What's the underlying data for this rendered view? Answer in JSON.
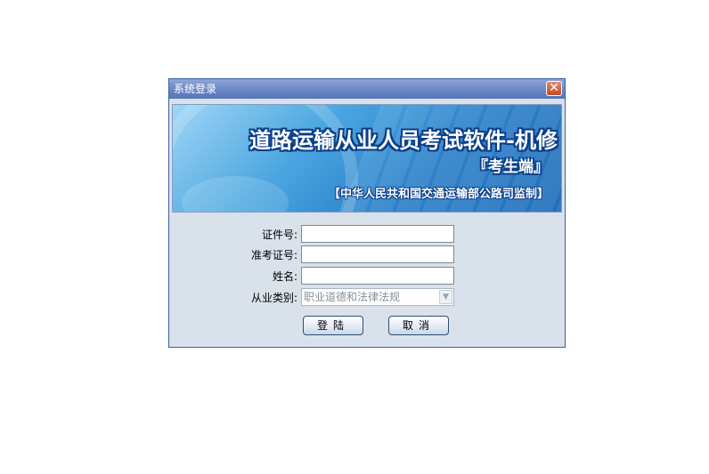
{
  "window": {
    "title": "系统登录",
    "close_glyph": "✕"
  },
  "banner": {
    "title": "道路运输从业人员考试软件-机修",
    "subtitle": "『考生端』",
    "note": "【中华人民共和国交通运输部公路司监制】"
  },
  "form": {
    "id_label": "证件号:",
    "id_value": "",
    "exam_label": "准考证号:",
    "exam_value": "",
    "name_label": "姓名:",
    "name_value": "",
    "category_label": "从业类别:",
    "category_value": "职业道德和法律法规",
    "category_arrow": "▼"
  },
  "buttons": {
    "login": "登陆",
    "cancel": "取消"
  },
  "colors": {
    "titlebar": "#6f8bc8",
    "window_bg": "#d9e1ea",
    "banner_blue": "#2a7fc8",
    "close_red": "#c4492b"
  }
}
